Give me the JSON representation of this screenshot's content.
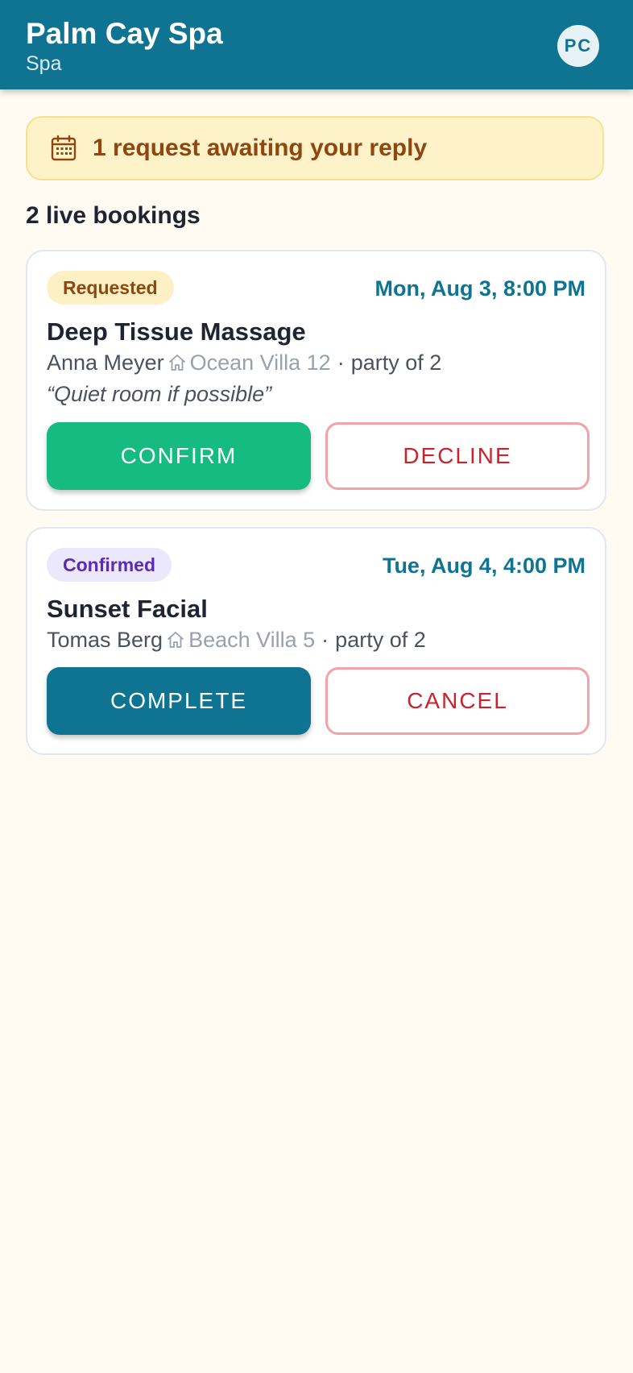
{
  "header": {
    "title": "Palm Cay Spa",
    "subtitle": "Spa",
    "avatar_initials": "PC"
  },
  "alert": {
    "icon": "calendar-icon",
    "text": "1 request awaiting your reply"
  },
  "section": {
    "title": "2 live bookings"
  },
  "bookings": [
    {
      "status": "Requested",
      "datetime": "Mon, Aug 3, 8:00 PM",
      "service": "Deep Tissue Massage",
      "guest": "Anna Meyer",
      "room_icon": "home-icon",
      "room": "Ocean Villa 12",
      "separator": "·",
      "party": "party of 2",
      "note": "“Quiet room if possible”",
      "primary_action": "CONFIRM",
      "secondary_action": "DECLINE"
    },
    {
      "status": "Confirmed",
      "datetime": "Tue, Aug 4, 4:00 PM",
      "service": "Sunset Facial",
      "guest": "Tomas Berg",
      "room_icon": "home-icon",
      "room": "Beach Villa 5",
      "separator": "·",
      "party": "party of 2",
      "primary_action": "COMPLETE",
      "secondary_action": "CANCEL"
    }
  ],
  "colors": {
    "header_bg": "#0f7392",
    "page_bg": "#fffbf2",
    "alert_bg": "#fef3c8",
    "alert_text": "#8f4610",
    "confirm_green": "#15bb80",
    "danger_red": "#c8242f",
    "requested_badge_bg": "#fdf0c4",
    "confirmed_badge_bg": "#ece8fb",
    "confirmed_badge_text": "#5b2bb5"
  }
}
